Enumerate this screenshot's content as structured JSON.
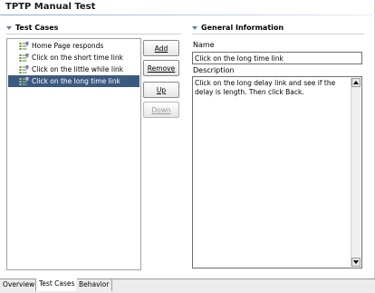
{
  "page": {
    "title": "TPTP Manual Test"
  },
  "test_cases": {
    "header": "Test Cases",
    "items": [
      {
        "label": "Home Page responds",
        "selected": false
      },
      {
        "label": "Click on the short time link",
        "selected": false
      },
      {
        "label": "Click on the little while link",
        "selected": false
      },
      {
        "label": "Click on the long time link",
        "selected": true
      }
    ],
    "buttons": {
      "add": "Add",
      "remove": "Remove",
      "up": "Up",
      "down": "Down"
    }
  },
  "general_info": {
    "header": "General Information",
    "name_label": "Name",
    "name_value": "Click on the long time link",
    "description_label": "Description",
    "description_value": "Click on the long delay link and see if the delay is length. Then click Back."
  },
  "tabs": [
    {
      "label": "Overview",
      "active": false
    },
    {
      "label": "Test Cases",
      "active": true
    },
    {
      "label": "Behavior",
      "active": false
    }
  ],
  "colors": {
    "selection": "#3b5a80",
    "header_rule": "#8fa8c8"
  },
  "icons": {
    "tree_item": "test-case-icon",
    "section_toggle": "twisty-down-icon"
  }
}
